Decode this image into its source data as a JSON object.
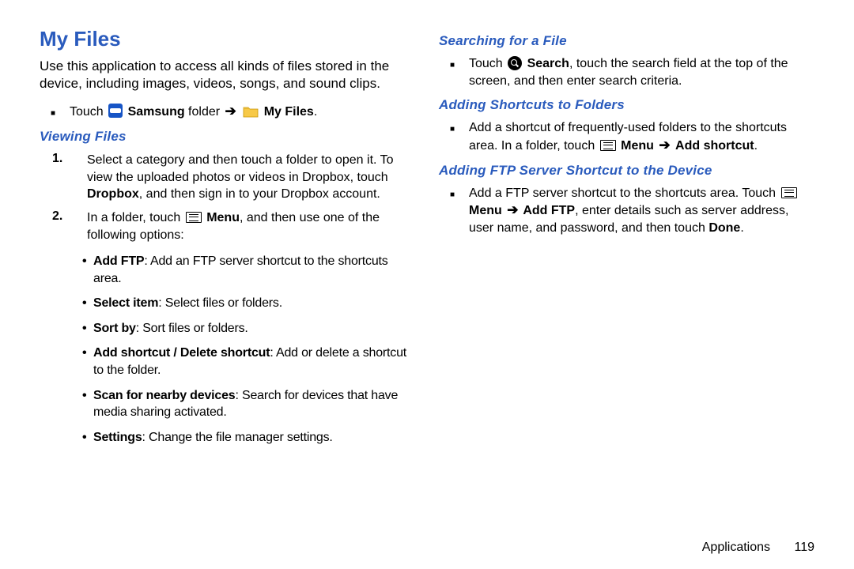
{
  "page": {
    "title": "My Files",
    "intro": "Use this application to access all kinds of files stored in the device, including images, videos, songs, and sound clips.",
    "nav_prefix": "Touch ",
    "nav_samsung": "Samsung",
    "nav_folder_word": " folder ",
    "nav_myfiles": " My Files",
    "nav_period": "."
  },
  "arrow": "➔",
  "left": {
    "h_viewing": "Viewing Files",
    "step1_a": "Select a category and then touch a folder to open it. To view the uploaded photos or videos in Dropbox, touch ",
    "step1_dropbox": "Dropbox",
    "step1_b": ", and then sign in to your Dropbox account.",
    "step2_a": "In a folder, touch ",
    "step2_menu": " Menu",
    "step2_b": ", and then use one of the following options:",
    "opts": [
      {
        "bold": "Add FTP",
        "rest": ": Add an FTP server shortcut to the shortcuts area."
      },
      {
        "bold": "Select item",
        "rest": ": Select files or folders."
      },
      {
        "bold": "Sort by",
        "rest": ": Sort files or folders."
      },
      {
        "bold": "Add shortcut / Delete shortcut",
        "rest": ": Add or delete a shortcut to the folder."
      },
      {
        "bold": "Scan for nearby devices",
        "rest": ": Search for devices that have media sharing activated."
      },
      {
        "bold": "Settings",
        "rest": ": Change the file manager settings."
      }
    ]
  },
  "right": {
    "h_search": "Searching for a File",
    "search_a": "Touch ",
    "search_bold": " Search",
    "search_b": ", touch the search field at the top of the screen, and then enter search criteria.",
    "h_shortcuts": "Adding Shortcuts to Folders",
    "shortcut_a": "Add a shortcut of frequently-used folders to the shortcuts area. In a folder, touch ",
    "shortcut_menu": " Menu ",
    "shortcut_add": "Add shortcut",
    "shortcut_period": ".",
    "h_ftp": "Adding FTP Server Shortcut to the Device",
    "ftp_a": "Add a FTP server shortcut to the shortcuts area. Touch ",
    "ftp_menu": " Menu ",
    "ftp_addftp": " Add FTP",
    "ftp_b": ", enter details such as server address, user name, and password, and then touch ",
    "ftp_done": "Done",
    "ftp_period": "."
  },
  "footer": {
    "section": "Applications",
    "page_no": "119"
  }
}
